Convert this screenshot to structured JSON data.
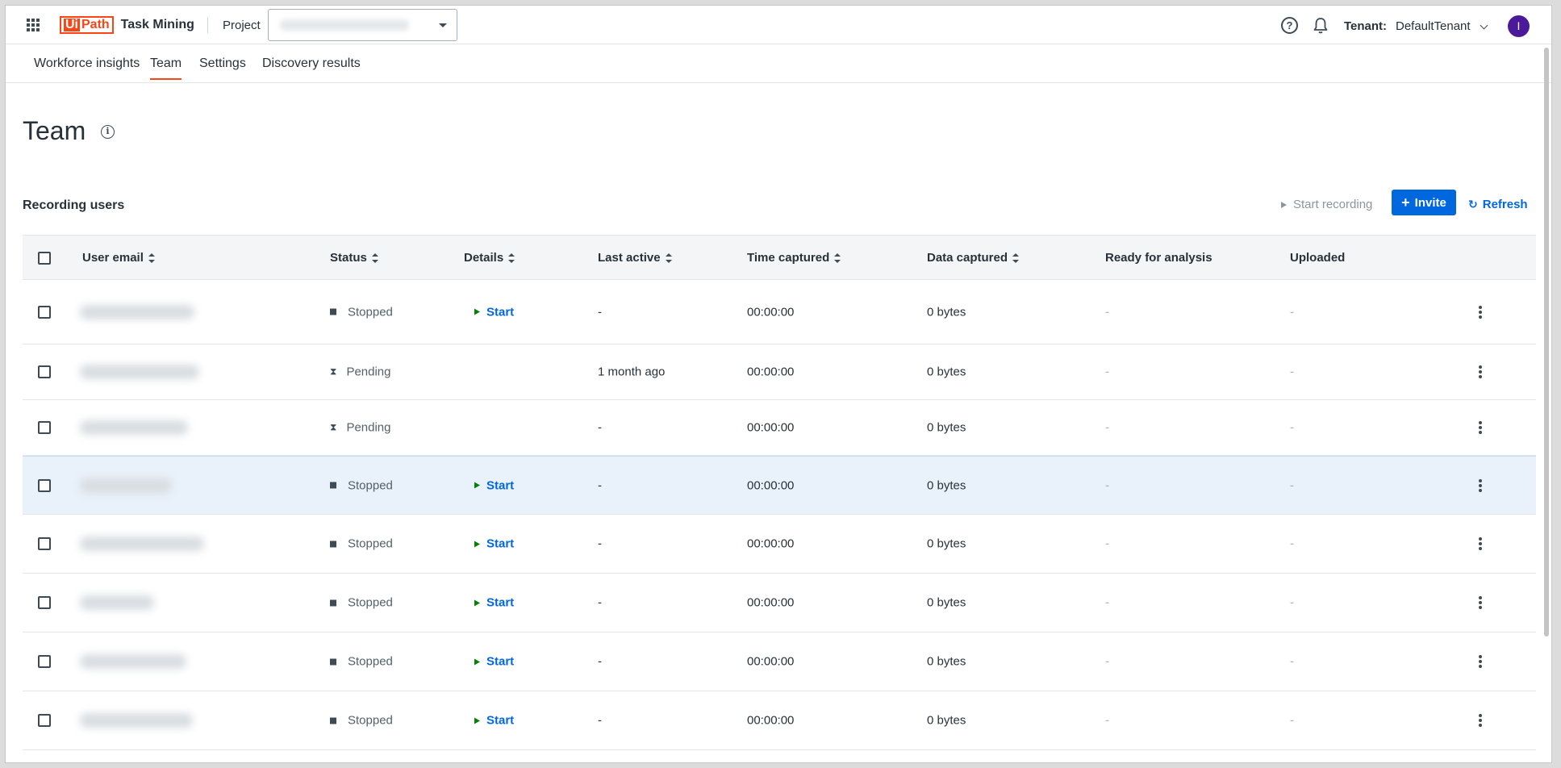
{
  "app": {
    "brand_box": "UiPath",
    "brand_ui": "Ui",
    "brand_path": "Path",
    "product": "Task Mining"
  },
  "header": {
    "project_label": "Project",
    "tenant_label": "Tenant:",
    "tenant_value": "DefaultTenant",
    "avatar_initial": "I",
    "help_glyph": "?"
  },
  "tabs": [
    {
      "label": "Workforce insights",
      "active": false
    },
    {
      "label": "Team",
      "active": true
    },
    {
      "label": "Settings",
      "active": false
    },
    {
      "label": "Discovery results",
      "active": false
    }
  ],
  "page": {
    "title": "Team",
    "info_glyph": "i"
  },
  "section": {
    "title": "Recording users",
    "start_recording_label": "Start recording",
    "invite_label": "Invite",
    "invite_plus": "+",
    "refresh_label": "Refresh",
    "refresh_glyph": "↻"
  },
  "table": {
    "columns": [
      "User email",
      "Status",
      "Details",
      "Last active",
      "Time captured",
      "Data captured",
      "Ready for analysis",
      "Uploaded"
    ],
    "rows": [
      {
        "status": "Stopped",
        "details": "Start",
        "last_active": "-",
        "time": "00:00:00",
        "data": "0 bytes",
        "ready": "-",
        "uploaded": "-"
      },
      {
        "status": "Pending",
        "details": "",
        "last_active": "1 month ago",
        "time": "00:00:00",
        "data": "0 bytes",
        "ready": "-",
        "uploaded": "-"
      },
      {
        "status": "Pending",
        "details": "",
        "last_active": "-",
        "time": "00:00:00",
        "data": "0 bytes",
        "ready": "-",
        "uploaded": "-"
      },
      {
        "status": "Stopped",
        "details": "Start",
        "last_active": "-",
        "time": "00:00:00",
        "data": "0 bytes",
        "ready": "-",
        "uploaded": "-",
        "selected": true
      },
      {
        "status": "Stopped",
        "details": "Start",
        "last_active": "-",
        "time": "00:00:00",
        "data": "0 bytes",
        "ready": "-",
        "uploaded": "-"
      },
      {
        "status": "Stopped",
        "details": "Start",
        "last_active": "-",
        "time": "00:00:00",
        "data": "0 bytes",
        "ready": "-",
        "uploaded": "-"
      },
      {
        "status": "Stopped",
        "details": "Start",
        "last_active": "-",
        "time": "00:00:00",
        "data": "0 bytes",
        "ready": "-",
        "uploaded": "-"
      },
      {
        "status": "Stopped",
        "details": "Start",
        "last_active": "-",
        "time": "00:00:00",
        "data": "0 bytes",
        "ready": "-",
        "uploaded": "-"
      }
    ]
  },
  "colors": {
    "accent_orange": "#fa4616",
    "primary_blue": "#0067df",
    "start_green": "#038108",
    "selected_row": "#e9f1fa",
    "avatar": "#4b1a9a"
  }
}
